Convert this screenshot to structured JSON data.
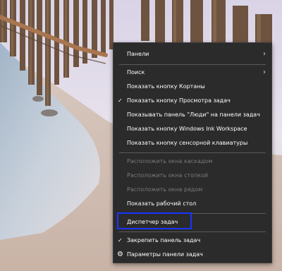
{
  "context_menu": {
    "items": [
      {
        "label": "Панели",
        "submenu": true
      },
      {
        "label": "Поиск",
        "submenu": true
      },
      {
        "label": "Показать кнопку Кортаны"
      },
      {
        "label": "Показать кнопку Просмотра задач",
        "checked": true
      },
      {
        "label": "Показывать панель \"Люди\" на панели задач"
      },
      {
        "label": "Показать кнопку Windows Ink Workspace"
      },
      {
        "label": "Показать кнопку сенсорной клавиатуры"
      },
      {
        "label": "Расположить окна каскадом",
        "disabled": true
      },
      {
        "label": "Расположить окна стопкой",
        "disabled": true
      },
      {
        "label": "Расположить окна рядом",
        "disabled": true
      },
      {
        "label": "Показать рабочий стол"
      },
      {
        "label": "Диспетчер задач",
        "highlighted": true
      },
      {
        "label": "Закрепить панель задач",
        "checked": true
      },
      {
        "label": "Параметры панели задач",
        "icon": "gear-icon"
      }
    ]
  },
  "icons": {
    "submenu": "chevron-right-icon",
    "checkmark": "checkmark-icon",
    "settings": "gear-icon"
  },
  "colors": {
    "menu_background": "#2b2b2b",
    "menu_text": "#ffffff",
    "disabled_text": "#7a7a7a",
    "highlight_border": "#1a35ff"
  }
}
